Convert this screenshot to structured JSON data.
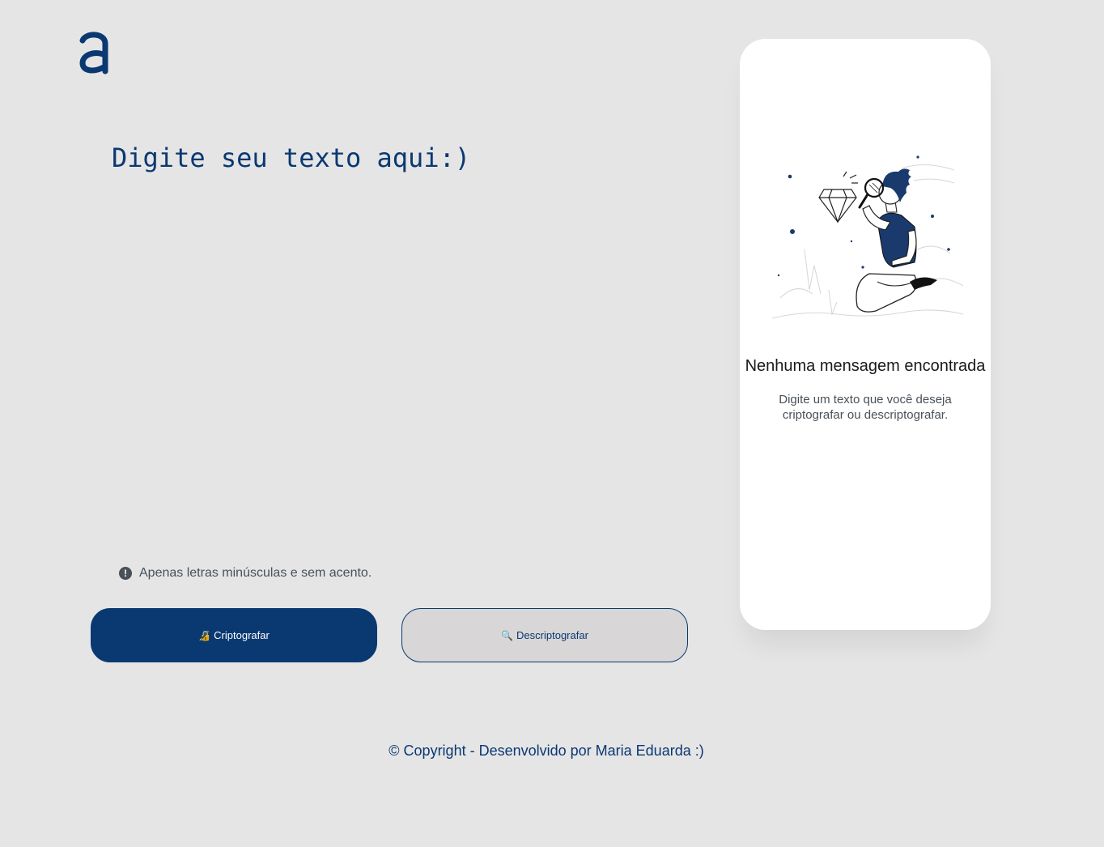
{
  "brand": {
    "logo_icon": "alura-a-logo-icon",
    "accent_color": "#0a3871"
  },
  "input": {
    "placeholder": "Digite seu texto aqui:)",
    "value": ""
  },
  "hint": {
    "icon": "exclamation-circle-icon",
    "text": "Apenas letras minúsculas e sem acento."
  },
  "buttons": {
    "encrypt": {
      "icon": "lock-emoji-icon",
      "label": "Criptografar"
    },
    "decrypt": {
      "icon": "magnifier-emoji-icon",
      "label": "Descriptografar"
    }
  },
  "result": {
    "illustration": "person-with-magnifying-glass-and-diamond-illustration",
    "title": "Nenhuma mensagem encontrada",
    "description": "Digite um texto que você deseja criptografar ou descriptografar."
  },
  "footer": {
    "text": "© Copyright - Desenvolvido por Maria Eduarda :)"
  }
}
